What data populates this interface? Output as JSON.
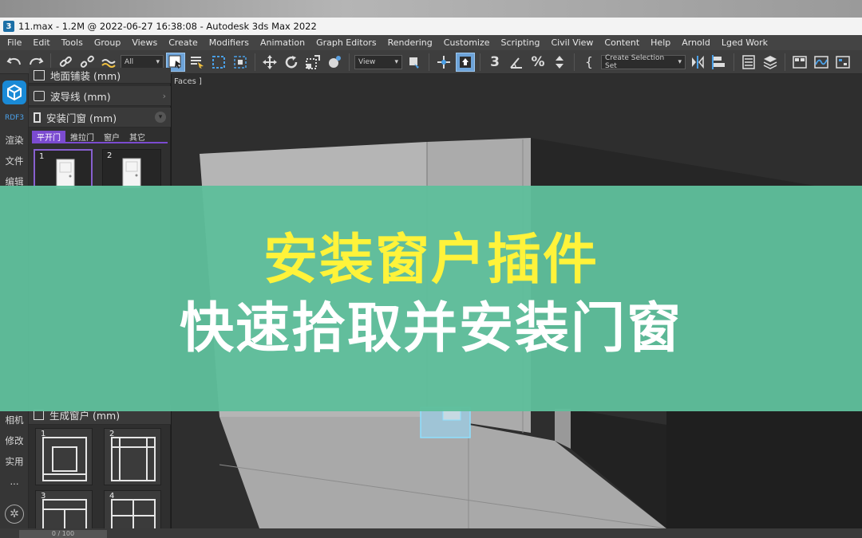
{
  "titlebar": {
    "app_icon_glyph": "3",
    "title": "11.max - 1.2M @ 2022-06-27 16:38:08 - Autodesk 3ds Max 2022"
  },
  "menu": [
    "File",
    "Edit",
    "Tools",
    "Group",
    "Views",
    "Create",
    "Modifiers",
    "Animation",
    "Graph Editors",
    "Rendering",
    "Customize",
    "Scripting",
    "Civil View",
    "Content",
    "Help",
    "Arnold",
    "Lged Work"
  ],
  "toolbar": {
    "filter_value": "All",
    "view_value": "View",
    "selection_set_value": "Create Selection Set",
    "icons": [
      "undo-icon",
      "redo-icon",
      "link-icon",
      "unlink-icon",
      "bind-space-warp-icon",
      "select-object-icon",
      "select-by-name-icon",
      "rect-select-icon",
      "window-crossing-icon",
      "move-icon",
      "rotate-icon",
      "scale-icon",
      "place-icon",
      "select-manipulate-icon",
      "snap-toggle-icon",
      "angle-snap-icon",
      "percent-snap-icon",
      "spinner-snap-icon",
      "edit-named-selection-icon",
      "mirror-icon",
      "align-icon",
      "scene-explorer-icon",
      "layer-explorer-icon",
      "ribbon-icon",
      "curve-editor-icon",
      "schematic-view-icon"
    ]
  },
  "left_bar": {
    "brand_text": "RDF3",
    "items": [
      "渲染",
      "文件",
      "编辑",
      "相机",
      "修改",
      "实用",
      "..."
    ]
  },
  "panel": {
    "header_top": "地面铺装 (mm)",
    "header_waveguide": "波导线 (mm)",
    "header_door": "安装门窗 (mm)",
    "subtabs": [
      "平开门",
      "推拉门",
      "窗户",
      "其它"
    ],
    "door_thumbs": [
      "1",
      "2"
    ],
    "header_window": "生成窗户 (mm)",
    "window_thumbs": [
      "1",
      "2",
      "3",
      "4"
    ]
  },
  "viewport": {
    "label": "Faces ]"
  },
  "bottom": {
    "time_slider": "0 / 100"
  },
  "banner": {
    "title": "安装窗户插件",
    "subtitle": "快速拾取并安装门窗",
    "title_color": "#fff33a",
    "bg_color": "#5fbe9b"
  }
}
